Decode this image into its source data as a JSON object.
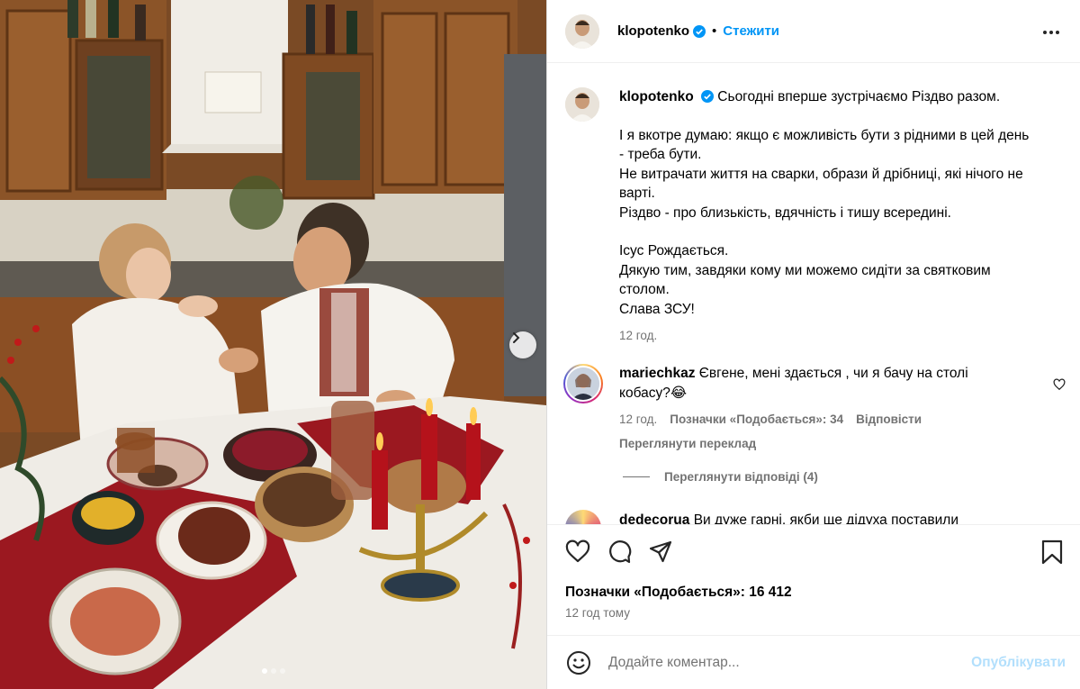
{
  "post": {
    "username": "klopotenko",
    "follow_label": "Стежити",
    "separator": "•"
  },
  "caption": {
    "username": "klopotenko",
    "first_line": "Сьогодні вперше зустрічаємо Різдво разом.",
    "lines_a": [
      "І я вкотре думаю: якщо є можливість бути з рідними в цей день",
      "- треба бути.",
      "Не витрачати життя на сварки, образи й дрібниці, які нічого не",
      "варті.",
      "Різдво - про близькість, вдячність і тишу всередині."
    ],
    "lines_b": [
      "Ісус Рождається.",
      "Дякую тим, завдяки кому ми можемо сидіти за святковим",
      "столом.",
      "Слава ЗСУ!"
    ],
    "time": "12 год."
  },
  "comment": {
    "username": "mariechkaz",
    "text_1": "Євгене, мені здається , чи я бачу на столі",
    "text_2": "кобасу?",
    "emoji": "😂",
    "time": "12 год.",
    "likes": "Позначки «Подобається»: 34",
    "reply": "Відповісти",
    "translate": "Переглянути переклад"
  },
  "replies": {
    "label": "Переглянути відповіді (4)"
  },
  "comment2": {
    "username": "dedecorua",
    "text": "Ви дуже гарні, якби ще дідуха поставили"
  },
  "stats": {
    "likes": "Позначки «Подобається»: 16 412",
    "time_ago": "12 год тому"
  },
  "composer": {
    "placeholder": "Додайте коментар...",
    "post_label": "Опублікувати"
  },
  "carousel": {
    "total": 3,
    "active": 1
  },
  "colors": {
    "accent": "#0095f6",
    "verified": "#0095f6",
    "post_disabled": "#b2dffc",
    "muted": "#737373"
  },
  "icons": [
    "verified-icon",
    "more-icon",
    "chevron-right-icon",
    "heart-icon",
    "comment-icon",
    "share-icon",
    "bookmark-icon",
    "emoji-icon"
  ]
}
